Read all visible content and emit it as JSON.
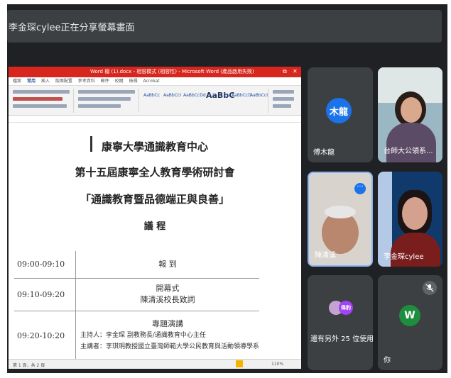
{
  "colors": {
    "meet_bg": "#202124",
    "tile_bg": "#3c4043",
    "word_red": "#d7261e",
    "active_speaker": "#8ab4f8",
    "avatar_blue": "#1a73e8",
    "avatar_green": "#1e8e3e",
    "avatar_purple": "#a142f4"
  },
  "topbar": {
    "share_text": "李金琛cylee正在分享螢幕畫面"
  },
  "word": {
    "title": "Word 檔 (1).docx - 相容模式 (相容性) - Microsoft Word (產品啟用失敗)",
    "ribbon_tabs": [
      "檔案",
      "常用",
      "插入",
      "版面配置",
      "參考資料",
      "郵件",
      "校閱",
      "檢視",
      "Acrobat"
    ],
    "style_samples": [
      "AaBbCc",
      "AaBbCcI",
      "AaBbCcDd",
      "AaBbC",
      "AaBbCcD",
      "AaBbCcI"
    ],
    "status_left": "第 1 頁，共 2 頁",
    "zoom": "110%"
  },
  "doc": {
    "line1": "康寧大學通識教育中心",
    "line2": "第十五屆康寧全人教育學術研討會",
    "line3": "「通識教育暨品德端正與良善」",
    "line4": "議 程",
    "agenda": [
      {
        "time": "09:00-09:10",
        "lines": [
          "報 到"
        ]
      },
      {
        "time": "09:10-09:20",
        "lines": [
          "開幕式",
          "陳清溪校長致詞"
        ]
      },
      {
        "time": "09:20-10:20",
        "lines": [
          "專題演講",
          "主持人：李金琛 副教務長/通識教育中心主任",
          "主講者：李琪明教授國立臺灣師範大學公民教育與活動領導學系"
        ]
      }
    ]
  },
  "participants": [
    {
      "name": "傅木龍",
      "initials": "木龍",
      "type": "avatar"
    },
    {
      "name": "台師大公領系...",
      "type": "video"
    },
    {
      "name": "陳清溪",
      "type": "video",
      "active": true
    },
    {
      "name": "李金琛cylee",
      "type": "video"
    },
    {
      "name": "還有另外 25 位使用者",
      "initials": "偉豹",
      "type": "group"
    },
    {
      "name": "你",
      "initials": "W",
      "type": "self"
    }
  ]
}
